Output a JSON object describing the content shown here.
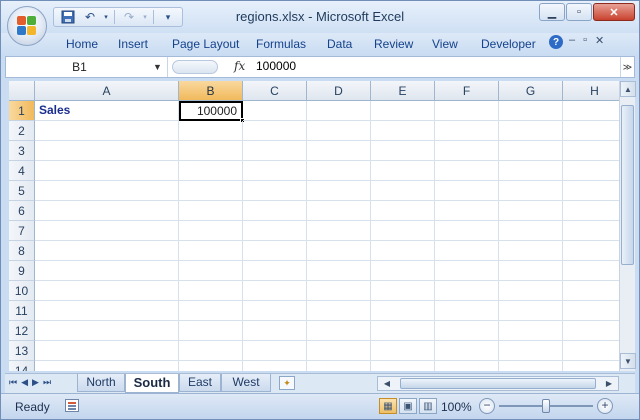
{
  "window": {
    "title": "regions.xlsx - Microsoft Excel"
  },
  "quick_access": {
    "icons": [
      "save-icon",
      "undo-icon",
      "redo-icon",
      "customize-icon"
    ]
  },
  "ribbon_tabs": [
    "Home",
    "Insert",
    "Page Layout",
    "Formulas",
    "Data",
    "Review",
    "View",
    "Developer"
  ],
  "formula_bar": {
    "name_box": "B1",
    "fx_label": "fx",
    "value": "100000"
  },
  "columns": [
    "A",
    "B",
    "C",
    "D",
    "E",
    "F",
    "G",
    "H"
  ],
  "rows": [
    "1",
    "2",
    "3",
    "4",
    "5",
    "6",
    "7",
    "8",
    "9",
    "10",
    "11",
    "12",
    "13",
    "14"
  ],
  "cells": {
    "A1": "Sales",
    "B1": "100000"
  },
  "selected": {
    "column": "B",
    "row": "1"
  },
  "sheets": [
    "North",
    "South",
    "East",
    "West"
  ],
  "active_sheet": "South",
  "status": {
    "text": "Ready",
    "zoom": "100%",
    "zoom_level": 1.0
  },
  "colors": {
    "accent": "#15428b",
    "selection_header": "#f1b95b"
  }
}
